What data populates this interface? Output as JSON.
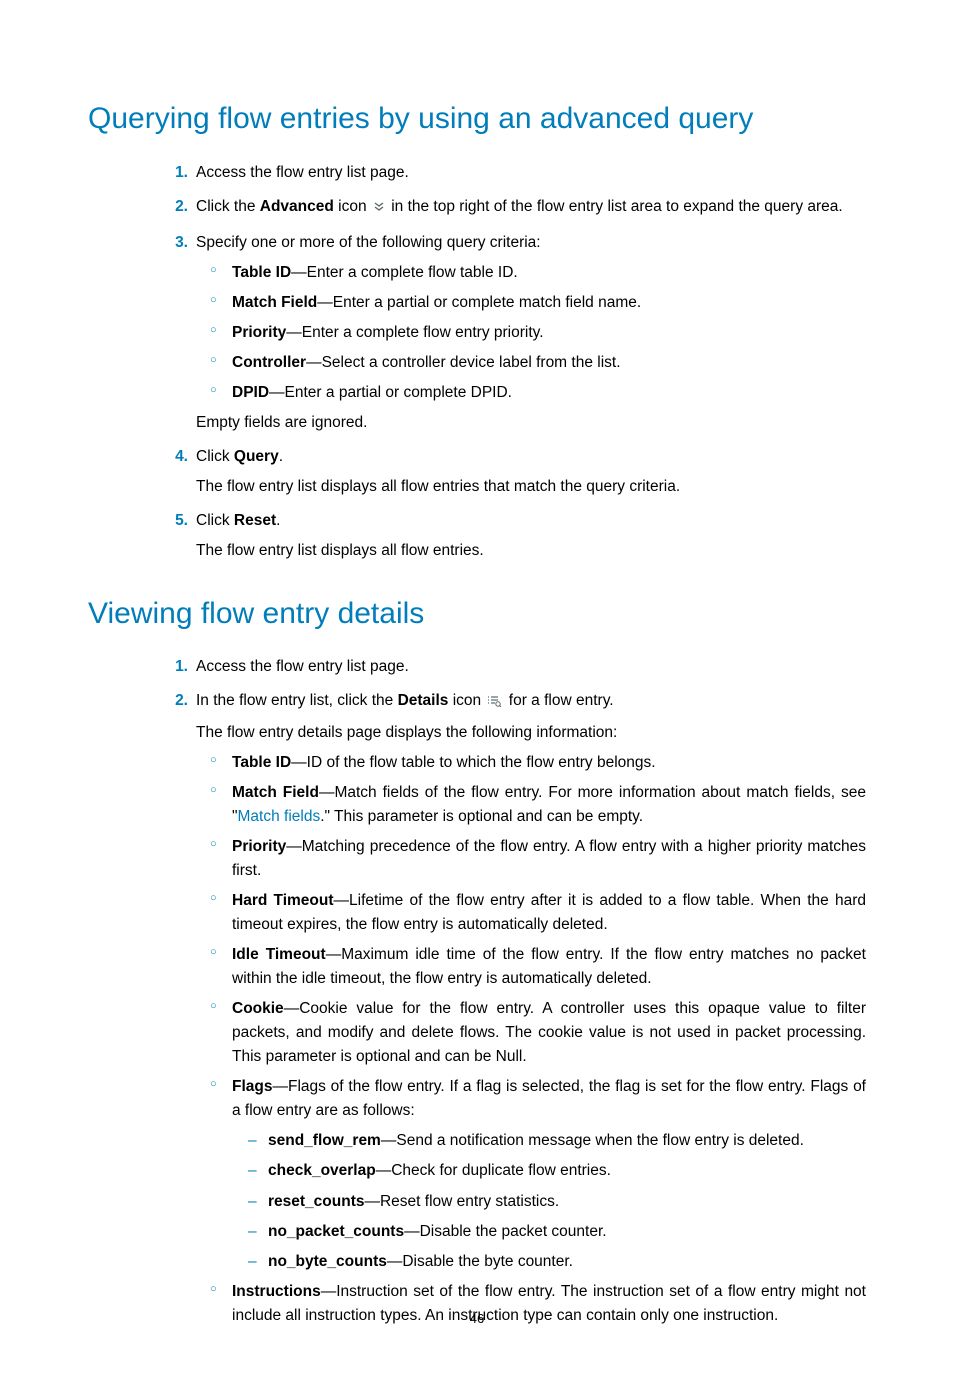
{
  "page_number": "46",
  "sections": {
    "query": {
      "title": "Querying flow entries by using an advanced query",
      "step1": "Access the flow entry list page.",
      "step2_pre": "Click the ",
      "step2_bold": "Advanced",
      "step2_mid": " icon ",
      "step2_post": " in the top right of the flow entry list area to expand the query area.",
      "step3": "Specify one or more of the following query criteria:",
      "criteria": {
        "table_id_label": "Table ID",
        "table_id_desc": "—Enter a complete flow table ID.",
        "match_field_label": "Match Field",
        "match_field_desc": "—Enter a partial or complete match field name.",
        "priority_label": "Priority",
        "priority_desc": "—Enter a complete flow entry priority.",
        "controller_label": "Controller",
        "controller_desc": "—Select a controller device label from the list.",
        "dpid_label": "DPID",
        "dpid_desc": "—Enter a partial or complete DPID."
      },
      "empty_note": "Empty fields are ignored.",
      "step4_pre": "Click ",
      "step4_bold": "Query",
      "step4_post": ".",
      "step4_note": "The flow entry list displays all flow entries that match the query criteria.",
      "step5_pre": "Click ",
      "step5_bold": "Reset",
      "step5_post": ".",
      "step5_note": "The flow entry list displays all flow entries."
    },
    "details": {
      "title": "Viewing flow entry details",
      "step1": "Access the flow entry list page.",
      "step2_pre": "In the flow entry list, click the ",
      "step2_bold": "Details",
      "step2_mid": " icon ",
      "step2_post": " for a flow entry.",
      "step2_note": "The flow entry details page displays the following information:",
      "info": {
        "table_id_label": "Table ID",
        "table_id_desc": "—ID of the flow table to which the flow entry belongs.",
        "match_field_label": "Match Field",
        "match_field_desc_pre": "—Match fields of the flow entry. For more information about match fields, see \"",
        "match_field_link": "Match fields",
        "match_field_desc_post": ".\" This parameter is optional and can be empty.",
        "priority_label": "Priority",
        "priority_desc": "—Matching precedence of the flow entry. A flow entry with a higher priority matches first.",
        "hard_timeout_label": "Hard Timeout",
        "hard_timeout_desc": "—Lifetime of the flow entry after it is added to a flow table. When the hard timeout expires, the flow entry is automatically deleted.",
        "idle_timeout_label": "Idle Timeout",
        "idle_timeout_desc": "—Maximum idle time of the flow entry. If the flow entry matches no packet within the idle timeout, the flow entry is automatically deleted.",
        "cookie_label": "Cookie",
        "cookie_desc": "—Cookie value for the flow entry. A controller uses this opaque value to filter packets, and modify and delete flows. The cookie value is not used in packet processing. This parameter is optional and can be Null.",
        "flags_label": "Flags",
        "flags_desc": "—Flags of the flow entry. If a flag is selected, the flag is set for the flow entry. Flags of a flow entry are as follows:",
        "flags": {
          "send_flow_rem_label": "send_flow_rem",
          "send_flow_rem_desc": "—Send a notification message when the flow entry is deleted.",
          "check_overlap_label": "check_overlap",
          "check_overlap_desc": "—Check for duplicate flow entries.",
          "reset_counts_label": "reset_counts",
          "reset_counts_desc": "—Reset flow entry statistics.",
          "no_packet_counts_label": "no_packet_counts",
          "no_packet_counts_desc": "—Disable the packet counter.",
          "no_byte_counts_label": "no_byte_counts",
          "no_byte_counts_desc": "—Disable the byte counter."
        },
        "instructions_label": "Instructions",
        "instructions_desc": "—Instruction set of the flow entry. The instruction set of a flow entry might not include all instruction types. An instruction type can contain only one instruction."
      }
    }
  }
}
